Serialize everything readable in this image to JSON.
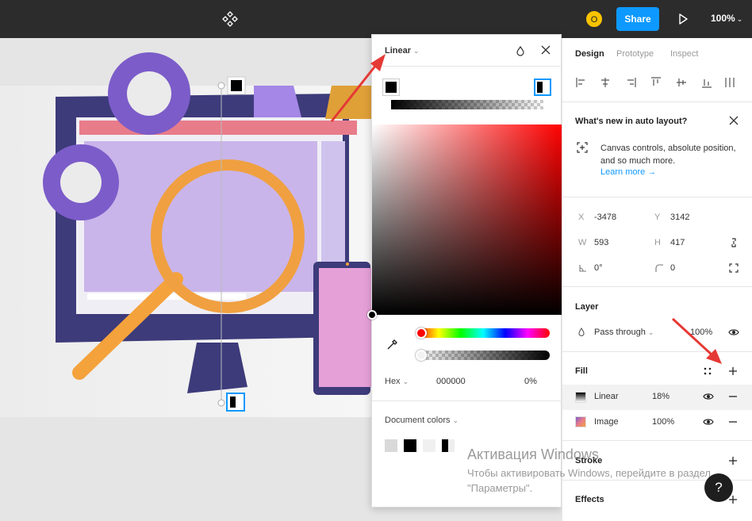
{
  "topbar": {
    "avatar_initial": "O",
    "share_label": "Share",
    "zoom_label": "100%"
  },
  "picker": {
    "type_label": "Linear",
    "hex_mode": "Hex",
    "hex_value": "000000",
    "opacity": "0%",
    "document_colors_label": "Document colors",
    "swatches": [
      "#d9d9d9",
      "#000000",
      "#f0f0f0",
      "half-black"
    ]
  },
  "panel": {
    "tabs": [
      "Design",
      "Prototype",
      "Inspect"
    ],
    "whats_new": {
      "title": "What's new in auto layout?",
      "body": "Canvas controls, absolute position, and so much more.",
      "link": "Learn more →"
    },
    "props": {
      "x_label": "X",
      "x": "-3478",
      "y_label": "Y",
      "y": "3142",
      "w_label": "W",
      "w": "593",
      "h_label": "H",
      "h": "417",
      "rotation": "0°",
      "radius": "0"
    },
    "layer": {
      "title": "Layer",
      "blend": "Pass through",
      "opacity": "100%"
    },
    "fill": {
      "title": "Fill",
      "items": [
        {
          "name": "Linear",
          "opacity": "18%"
        },
        {
          "name": "Image",
          "opacity": "100%"
        }
      ]
    },
    "stroke_title": "Stroke",
    "effects_title": "Effects"
  },
  "watermark": {
    "title": "Активация Windows",
    "subtitle": "Чтобы активировать Windows, перейдите в раздел \"Параметры\"."
  },
  "help_label": "?",
  "colors": {
    "accent": "#0d99ff",
    "topbar": "#2c2c2c",
    "arrow": "#e53935"
  }
}
